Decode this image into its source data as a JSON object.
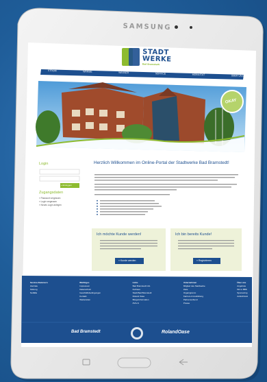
{
  "device": {
    "brand": "SAMSUNG"
  },
  "site": {
    "logo_line1": "STADT",
    "logo_line2": "WERKE",
    "logo_sub": "Bad Bramstedt",
    "nav": [
      "STROM",
      "WÄRME",
      "WASSER",
      "SERVICE",
      "MOBILITÄT",
      "ÜBER UNS"
    ],
    "okay_badge": "OKAY",
    "welcome_title": "Herzlich Willkommen im Online-Portal der Stadtwerke Bad Bramstedt!",
    "login_title": "Login",
    "login_button": "» Einloggen",
    "links_title": "Zugangsdaten",
    "links": [
      "» Passwort vergessen",
      "» Login vergessen",
      "» Neues Login anlegen"
    ],
    "card_new_title": "Ich möchte Kunde werden!",
    "card_new_button": "» Kunde werden",
    "card_existing_title": "Ich bin bereits Kunde!",
    "card_existing_button": "» Registrieren",
    "footer_col1_title": "Service-Nummern",
    "footer_col1_items": [
      "Zentrale",
      "Störung",
      "Notfälle"
    ],
    "footer_col2_title": "Wichtiges",
    "footer_col2_items": [
      "Impressum",
      "Datenschutz",
      "Geschäftsbedingungen",
      "Kontakt",
      "Wartezeiten"
    ],
    "footer_col3_title": "Links",
    "footer_col3_items": [
      "Bad Bramstedt Info",
      "Kurhaus",
      "Stadt Bad Bramstedt",
      "Roland Oase",
      "Bürgerinformation",
      "ZVG-S"
    ],
    "footer_col4_title": "Unternehmen",
    "footer_col4_items": [
      "Mitglied des Stadtwerke",
      "Ziele",
      "Organigramm",
      "Karriere & Ausbildung",
      "Partnerverbund",
      "Presse"
    ],
    "footer_col5_title": "Über uns",
    "footer_col5_items": [
      "Angebote",
      "Wir in BBS",
      "Sponsoring",
      "Aufsichtsrat"
    ],
    "footer_logo1": "Bad Bramstedt",
    "footer_logo3": "RolandOase"
  },
  "colors": {
    "background": "#1f5d99",
    "site_blue": "#1d4f8f",
    "accent_green": "#8dbb2f",
    "card_bg": "#eef2d9"
  }
}
